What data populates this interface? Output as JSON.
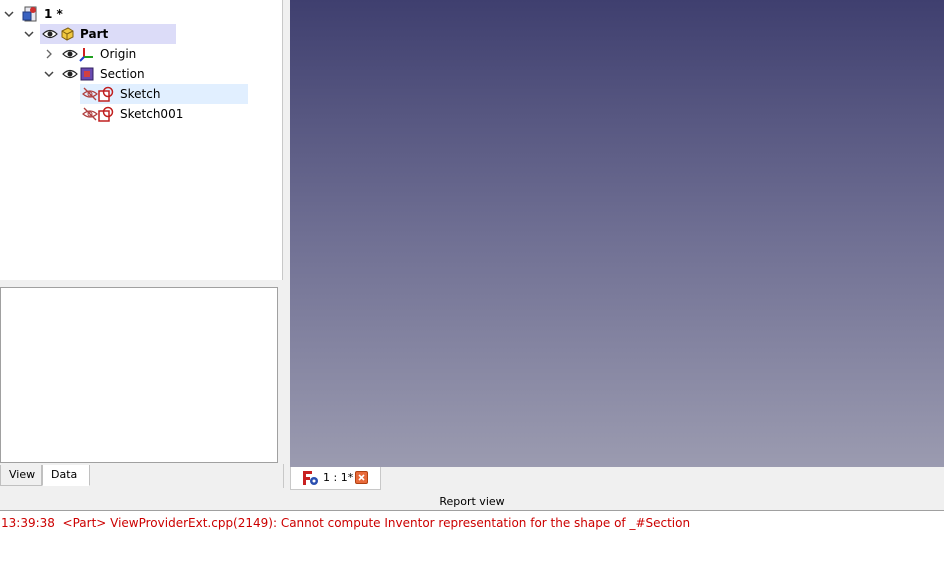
{
  "tree": {
    "doc": {
      "label": "1 *"
    },
    "items": [
      {
        "label": "Part",
        "bold": true
      },
      {
        "label": "Origin"
      },
      {
        "label": "Section"
      },
      {
        "label": "Sketch"
      },
      {
        "label": "Sketch001"
      }
    ]
  },
  "property_tabs": {
    "view": "View",
    "data": "Data"
  },
  "mdi": {
    "tab_label": "1 : 1*"
  },
  "report": {
    "title": "Report view",
    "line": "13:39:38  <Part> ViewProviderExt.cpp(2149): Cannot compute Inventor representation for the shape of _#Section"
  },
  "colors": {
    "error_text": "#cc0000",
    "selection": "#dcdcf8",
    "hover": "#e1efff"
  }
}
